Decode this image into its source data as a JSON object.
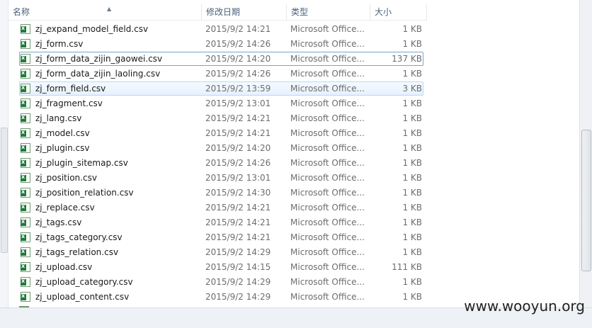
{
  "columns": {
    "name": "名称",
    "modified": "修改日期",
    "type": "类型",
    "size": "大小"
  },
  "files": [
    {
      "name": "zj_expand_model_field.csv",
      "modified": "2015/9/2 14:21",
      "type": "Microsoft Office...",
      "size": "1 KB"
    },
    {
      "name": "zj_form.csv",
      "modified": "2015/9/2 14:26",
      "type": "Microsoft Office...",
      "size": "1 KB"
    },
    {
      "name": "zj_form_data_zijin_gaowei.csv",
      "modified": "2015/9/2 14:20",
      "type": "Microsoft Office...",
      "size": "137 KB",
      "state": "selected"
    },
    {
      "name": "zj_form_data_zijin_laoling.csv",
      "modified": "2015/9/2 14:26",
      "type": "Microsoft Office...",
      "size": "1 KB"
    },
    {
      "name": "zj_form_field.csv",
      "modified": "2015/9/2 13:59",
      "type": "Microsoft Office...",
      "size": "3 KB",
      "state": "hover"
    },
    {
      "name": "zj_fragment.csv",
      "modified": "2015/9/2 13:01",
      "type": "Microsoft Office...",
      "size": "1 KB"
    },
    {
      "name": "zj_lang.csv",
      "modified": "2015/9/2 14:21",
      "type": "Microsoft Office...",
      "size": "1 KB"
    },
    {
      "name": "zj_model.csv",
      "modified": "2015/9/2 14:21",
      "type": "Microsoft Office...",
      "size": "1 KB"
    },
    {
      "name": "zj_plugin.csv",
      "modified": "2015/9/2 14:20",
      "type": "Microsoft Office...",
      "size": "1 KB"
    },
    {
      "name": "zj_plugin_sitemap.csv",
      "modified": "2015/9/2 14:26",
      "type": "Microsoft Office...",
      "size": "1 KB"
    },
    {
      "name": "zj_position.csv",
      "modified": "2015/9/2 13:01",
      "type": "Microsoft Office...",
      "size": "1 KB"
    },
    {
      "name": "zj_position_relation.csv",
      "modified": "2015/9/2 14:30",
      "type": "Microsoft Office...",
      "size": "1 KB"
    },
    {
      "name": "zj_replace.csv",
      "modified": "2015/9/2 14:21",
      "type": "Microsoft Office...",
      "size": "1 KB"
    },
    {
      "name": "zj_tags.csv",
      "modified": "2015/9/2 14:21",
      "type": "Microsoft Office...",
      "size": "1 KB"
    },
    {
      "name": "zj_tags_category.csv",
      "modified": "2015/9/2 14:21",
      "type": "Microsoft Office...",
      "size": "1 KB"
    },
    {
      "name": "zj_tags_relation.csv",
      "modified": "2015/9/2 14:29",
      "type": "Microsoft Office...",
      "size": "1 KB"
    },
    {
      "name": "zj_upload.csv",
      "modified": "2015/9/2 14:15",
      "type": "Microsoft Office...",
      "size": "111 KB"
    },
    {
      "name": "zj_upload_category.csv",
      "modified": "2015/9/2 14:29",
      "type": "Microsoft Office...",
      "size": "1 KB"
    },
    {
      "name": "zj_upload_content.csv",
      "modified": "2015/9/2 14:29",
      "type": "Microsoft Office...",
      "size": "1 KB"
    }
  ],
  "icon": "excel-csv-file-icon",
  "colors": {
    "selected_border": "#7da2ce",
    "hover_border": "#b8d6fb",
    "excel_green": "#1d7b3a"
  },
  "watermark": "www.wooyun.org"
}
